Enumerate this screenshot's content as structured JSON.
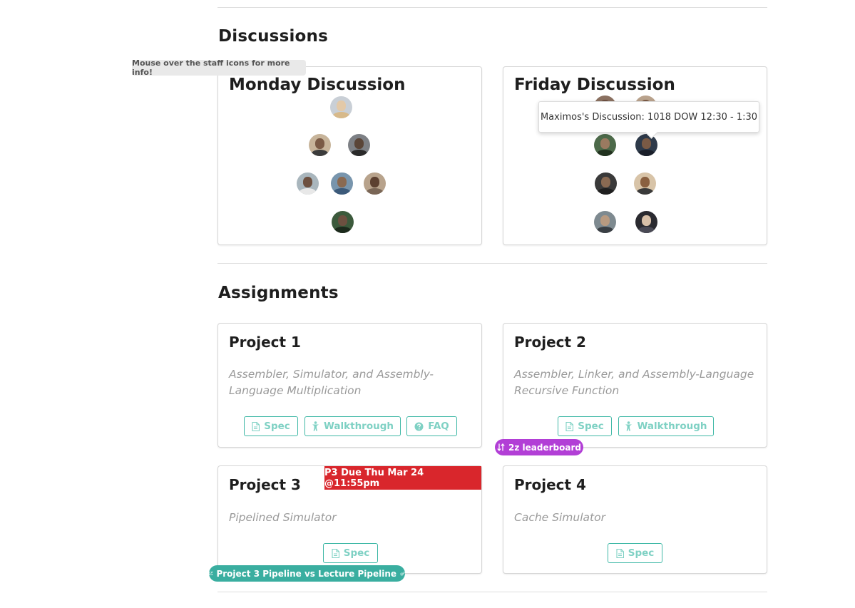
{
  "discussions": {
    "title": "Discussions",
    "hint": "Mouse over the staff icons for more info!",
    "cards": [
      {
        "title": "Monday Discussion"
      },
      {
        "title": "Friday Discussion"
      }
    ],
    "tooltip": "Maximos's Discussion: 1018 DOW 12:30 - 1:30"
  },
  "assignments": {
    "title": "Assignments",
    "projects": [
      {
        "title": "Project 1",
        "description": "Assembler, Simulator, and Assembly-Language Multiplication",
        "buttons": [
          "Spec",
          "Walkthrough",
          "FAQ"
        ]
      },
      {
        "title": "Project 2",
        "description": "Assembler, Linker, and Assembly-Language Recursive Function",
        "buttons": [
          "Spec",
          "Walkthrough"
        ],
        "tag": "2z leaderboard"
      },
      {
        "title": "Project 3",
        "description": "Pipelined Simulator",
        "buttons": [
          "Spec"
        ],
        "due": "P3 Due Thu Mar 24 @11:55pm",
        "tag": "Project 3 Pipeline vs Lecture Pipeline"
      },
      {
        "title": "Project 4",
        "description": "Cache Simulator",
        "buttons": [
          "Spec"
        ]
      }
    ]
  },
  "colors": {
    "accent_teal": "#3fb8a6",
    "purple_tag": "#b23fd6",
    "teal_tag": "#3aaea0",
    "due_red": "#d9262c"
  },
  "icons": {
    "spec": "file-icon",
    "walkthrough": "walk-icon",
    "faq": "question-circle-icon",
    "leaderboard": "sort-icon",
    "external": "external-link-icon",
    "gears": "gears-icon"
  }
}
